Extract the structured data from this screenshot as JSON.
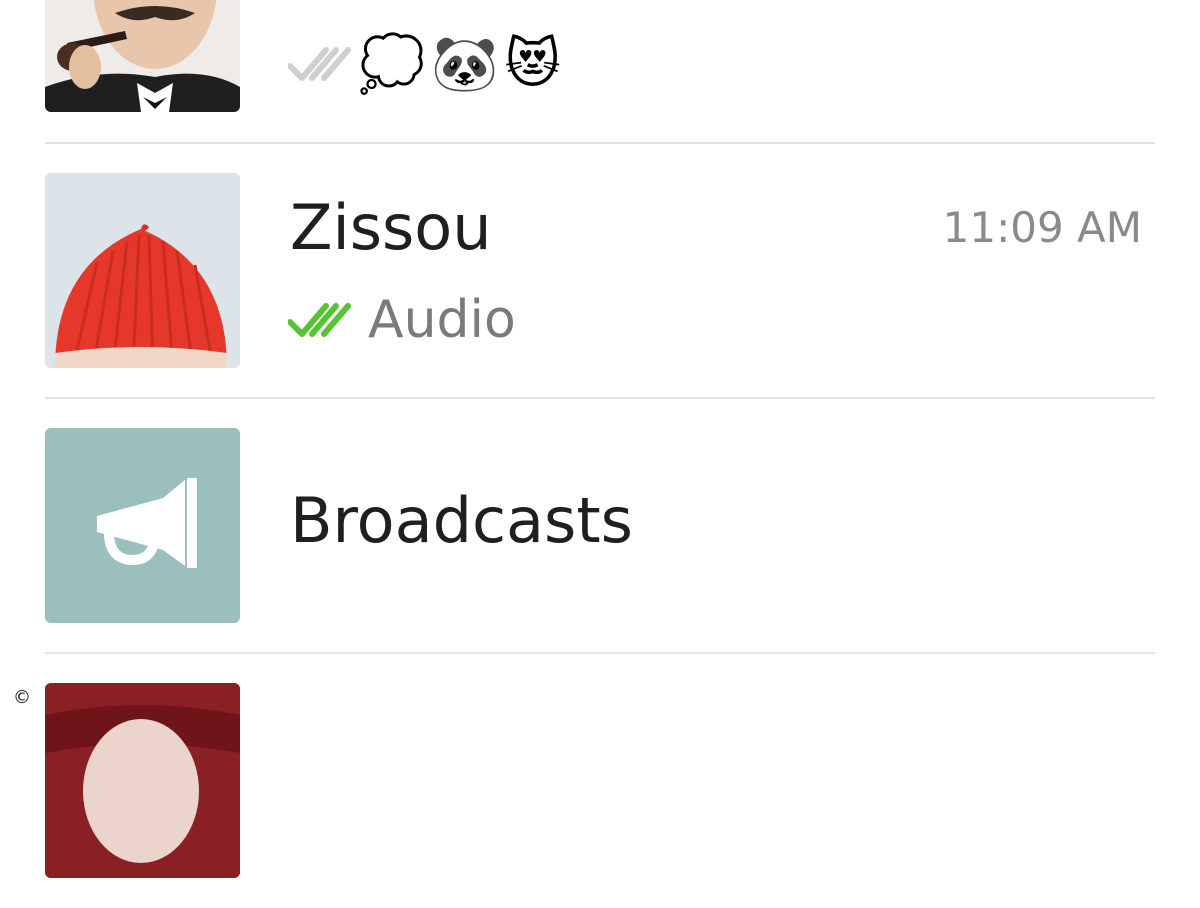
{
  "chats": [
    {
      "name": "",
      "time": "",
      "preview_text": "",
      "emoji": [
        "💭",
        "🐼",
        "😻"
      ],
      "ticks_color": "#cfcfcf",
      "avatar_icon": "mustache-pipe-man-photo"
    },
    {
      "name": "Zissou",
      "time": "11:09 AM",
      "preview_text": "Audio",
      "ticks_color": "#58c235",
      "avatar_icon": "red-beanie-photo"
    },
    {
      "name": "Broadcasts",
      "time": "",
      "preview_text": "",
      "avatar_color": "#9bbfbd",
      "avatar_icon": "megaphone-icon"
    },
    {
      "name": "",
      "time": "",
      "preview_text": "",
      "avatar_icon": "maroon-beanie-photo"
    }
  ],
  "copyright_symbol": "©"
}
